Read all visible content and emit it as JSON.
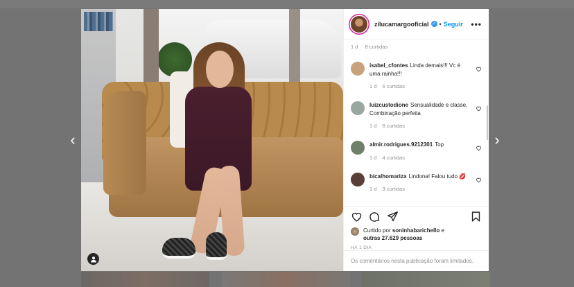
{
  "post": {
    "username": "zilucamargooficial",
    "separator": "•",
    "follow_label": "Seguir",
    "more_label": "•••",
    "verified_mark": "✓"
  },
  "nav": {
    "prev": "‹",
    "next": "›"
  },
  "comments_top_stats": {
    "time": "1 d",
    "likes": "8 curtidas"
  },
  "comments": [
    {
      "user": "isabel_cfontes",
      "text": "Linda demais!!! Vc é uma rainha!!!",
      "time": "1 d",
      "likes": "6 curtidas",
      "avatar_color": "#c8a27c"
    },
    {
      "user": "luizcustodione",
      "text": "Sensualidade e classe. Combinação perfeita",
      "time": "1 d",
      "likes": "6 curtidas",
      "avatar_color": "#9aa7a0"
    },
    {
      "user": "almir.rodrigues.9212301",
      "text": "Top",
      "time": "1 d",
      "likes": "4 curtidas",
      "avatar_color": "#6f7f6a"
    },
    {
      "user": "bicalhomariza",
      "text": "Lindona! Falou tudo 💋",
      "time": "1 d",
      "likes": "3 curtidas",
      "avatar_color": "#5a3e38"
    }
  ],
  "likes": {
    "prefix": "Curtido por",
    "user": "soninhabarichello",
    "connector": "e",
    "others": "outras 27.629 pessoas"
  },
  "timestamp": "HÁ 1 DIA",
  "footer": "Os comentários nesta publicação foram limitados.",
  "icons": {
    "like": "heart-icon",
    "comment": "comment-icon",
    "share": "share-icon",
    "save": "bookmark-icon",
    "tag": "user-tag-icon"
  },
  "colors": {
    "follow": "#0095f6",
    "verified": "#3897f0",
    "text": "#262626",
    "muted": "#8e8e8e"
  }
}
